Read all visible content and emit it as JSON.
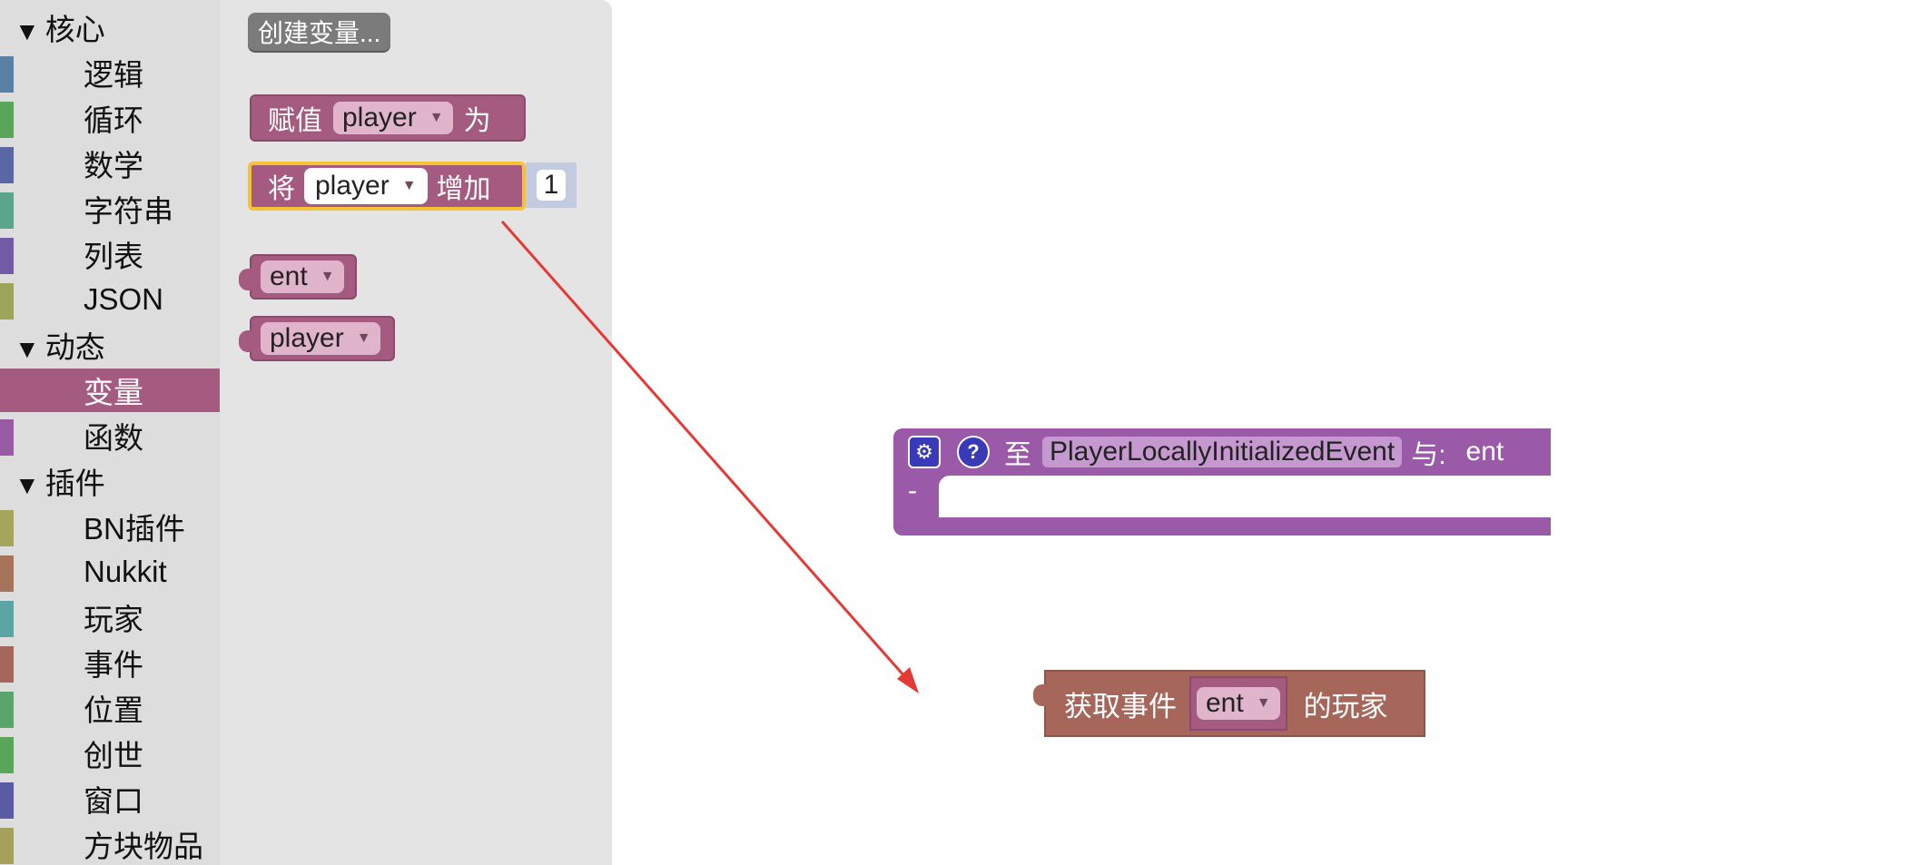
{
  "toolbox": {
    "categories": [
      {
        "label": "核心",
        "items": [
          {
            "label": "逻辑",
            "color": "#5b80a5"
          },
          {
            "label": "循环",
            "color": "#5ba55b"
          },
          {
            "label": "数学",
            "color": "#5b67a5"
          },
          {
            "label": "字符串",
            "color": "#5ba58c"
          },
          {
            "label": "列表",
            "color": "#745ba5"
          },
          {
            "label": "JSON",
            "color": "#9ba55b"
          }
        ]
      },
      {
        "label": "动态",
        "items": [
          {
            "label": "变量",
            "color": "#a55b80",
            "selected": true
          },
          {
            "label": "函数",
            "color": "#9a5ba5"
          }
        ]
      },
      {
        "label": "插件",
        "items": [
          {
            "label": "BN插件",
            "color": "#a5a55b"
          },
          {
            "label": "Nukkit",
            "color": "#a5745b"
          },
          {
            "label": "玩家",
            "color": "#5ba5a5"
          },
          {
            "label": "事件",
            "color": "#a5665b"
          },
          {
            "label": "位置",
            "color": "#5ba56b"
          },
          {
            "label": "创世",
            "color": "#5ba55b"
          },
          {
            "label": "窗口",
            "color": "#5b5ba5"
          },
          {
            "label": "方块物品",
            "color": "#a5a05b"
          }
        ]
      }
    ],
    "arrow": "▼"
  },
  "flyout": {
    "create_variable": "创建变量...",
    "set_block": {
      "prefix": "赋值",
      "var": "player",
      "suffix": "为"
    },
    "change_block": {
      "prefix": "将",
      "var": "player",
      "middle": "增加",
      "amount": "1"
    },
    "getters": [
      "ent",
      "player"
    ]
  },
  "workspace": {
    "event_block": {
      "to_label": "至",
      "event_name": "PlayerLocallyInitializedEvent",
      "with_label": "与:",
      "param": "ent",
      "minus": "-",
      "gear_icon": "⚙",
      "help_icon": "?"
    },
    "get_player_block": {
      "prefix": "获取事件",
      "var": "ent",
      "suffix": "的玩家"
    }
  },
  "colors": {
    "variables": "#a55b80",
    "events": "#9a5aa8",
    "event_action": "#a6665a",
    "arrow": "#e53935"
  }
}
